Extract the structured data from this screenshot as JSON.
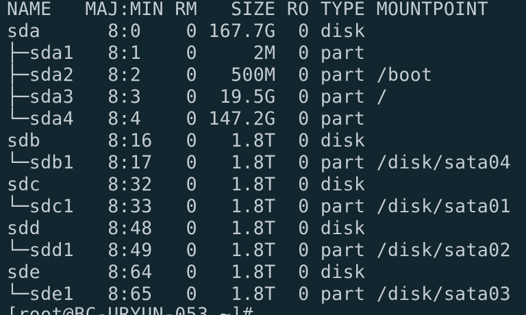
{
  "terminal": {
    "colors": {
      "background": "#12262f",
      "text": "#c3ccd0"
    },
    "lines": [
      "NAME   MAJ:MIN RM   SIZE RO TYPE MOUNTPOINT",
      "sda      8:0    0 167.7G  0 disk",
      "├─sda1   8:1    0     2M  0 part",
      "├─sda2   8:2    0   500M  0 part /boot",
      "├─sda3   8:3    0  19.5G  0 part /",
      "└─sda4   8:4    0 147.2G  0 part",
      "sdb      8:16   0   1.8T  0 disk",
      "└─sdb1   8:17   0   1.8T  0 part /disk/sata04",
      "sdc      8:32   0   1.8T  0 disk",
      "└─sdc1   8:33   0   1.8T  0 part /disk/sata01",
      "sdd      8:48   0   1.8T  0 disk",
      "└─sdd1   8:49   0   1.8T  0 part /disk/sata02",
      "sde      8:64   0   1.8T  0 disk",
      "└─sde1   8:65   0   1.8T  0 part /disk/sata03",
      "[root@BC-URYUN-053 ~]#"
    ]
  }
}
